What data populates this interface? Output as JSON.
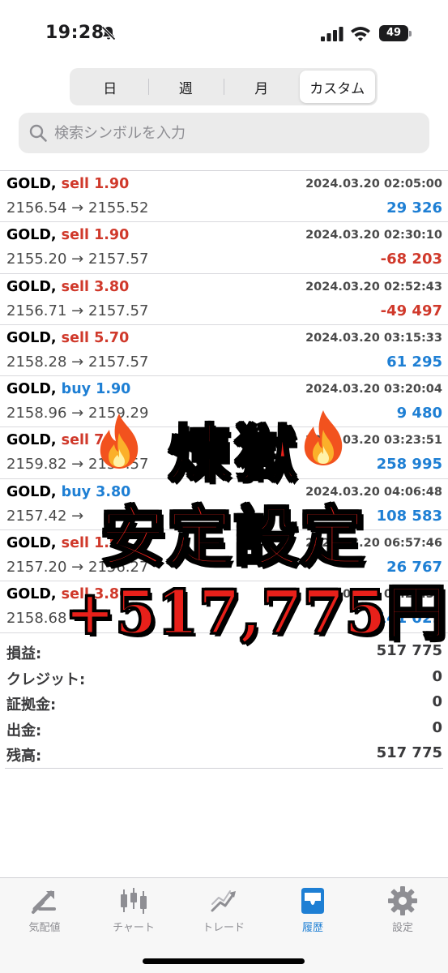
{
  "status_bar": {
    "time": "19:28",
    "battery": "49"
  },
  "segments": [
    {
      "label": "日",
      "active": false
    },
    {
      "label": "週",
      "active": false
    },
    {
      "label": "月",
      "active": false
    },
    {
      "label": "カスタム",
      "active": true
    }
  ],
  "search": {
    "placeholder": "検索シンボルを入力"
  },
  "trades": [
    {
      "symbol": "GOLD,",
      "side": "sell",
      "volume": "1.90",
      "datetime": "2024.03.20 02:05:00",
      "open_price": "2156.54",
      "arrow": "→",
      "close_price": "2155.52",
      "profit": "29 326",
      "profit_sign": "pos"
    },
    {
      "symbol": "GOLD,",
      "side": "sell",
      "volume": "1.90",
      "datetime": "2024.03.20 02:30:10",
      "open_price": "2155.20",
      "arrow": "→",
      "close_price": "2157.57",
      "profit": "-68 203",
      "profit_sign": "neg"
    },
    {
      "symbol": "GOLD,",
      "side": "sell",
      "volume": "3.80",
      "datetime": "2024.03.20 02:52:43",
      "open_price": "2156.71",
      "arrow": "→",
      "close_price": "2157.57",
      "profit": "-49 497",
      "profit_sign": "neg"
    },
    {
      "symbol": "GOLD,",
      "side": "sell",
      "volume": "5.70",
      "datetime": "2024.03.20 03:15:33",
      "open_price": "2158.28",
      "arrow": "→",
      "close_price": "2157.57",
      "profit": "61 295",
      "profit_sign": "pos"
    },
    {
      "symbol": "GOLD,",
      "side": "buy",
      "volume": "1.90",
      "datetime": "2024.03.20 03:20:04",
      "open_price": "2158.96",
      "arrow": "→",
      "close_price": "2159.29",
      "profit": "9 480",
      "profit_sign": "pos"
    },
    {
      "symbol": "GOLD,",
      "side": "sell",
      "volume": "7.",
      "datetime": "2024.03.20 03:23:51",
      "open_price": "2159.82",
      "arrow": "→",
      "close_price": "2157.57",
      "profit": "258 995",
      "profit_sign": "pos"
    },
    {
      "symbol": "GOLD,",
      "side": "buy",
      "volume": "3.80",
      "datetime": "2024.03.20 04:06:48",
      "open_price": "2157.42",
      "arrow": "→",
      "close_price": "",
      "profit": "108 583",
      "profit_sign": "pos"
    },
    {
      "symbol": "GOLD,",
      "side": "sell",
      "volume": "1.90",
      "datetime": "2024.03.20 06:57:46",
      "open_price": "2157.20",
      "arrow": "→",
      "close_price": "2156.27",
      "profit": "26 767",
      "profit_sign": "pos"
    },
    {
      "symbol": "GOLD,",
      "side": "sell",
      "volume": "3.80",
      "datetime": "2024.03.20 09:26:39",
      "open_price": "2158.68",
      "arrow": "→",
      "close_price": "",
      "profit": "141 029",
      "profit_sign": "pos"
    }
  ],
  "summary": [
    {
      "label": "損益:",
      "value": "517 775"
    },
    {
      "label": "クレジット:",
      "value": "0"
    },
    {
      "label": "証拠金:",
      "value": "0"
    },
    {
      "label": "出金:",
      "value": "0"
    },
    {
      "label": "残高:",
      "value": "517 775"
    }
  ],
  "overlay": {
    "line1": "煉獄",
    "line2": "安定設定",
    "line3": "+517,775円"
  },
  "tabs": [
    {
      "label": "気配値",
      "icon": "quotes-icon",
      "active": false
    },
    {
      "label": "チャート",
      "icon": "candlestick-icon",
      "active": false
    },
    {
      "label": "トレード",
      "icon": "trade-icon",
      "active": false
    },
    {
      "label": "履歴",
      "icon": "history-inbox-icon",
      "active": true
    },
    {
      "label": "設定",
      "icon": "gear-icon",
      "active": false
    }
  ],
  "colors": {
    "sell": "#d0392b",
    "buy": "#1e7fd4",
    "overlay_text": "#e8201a",
    "active_tab": "#1e7fd4"
  }
}
